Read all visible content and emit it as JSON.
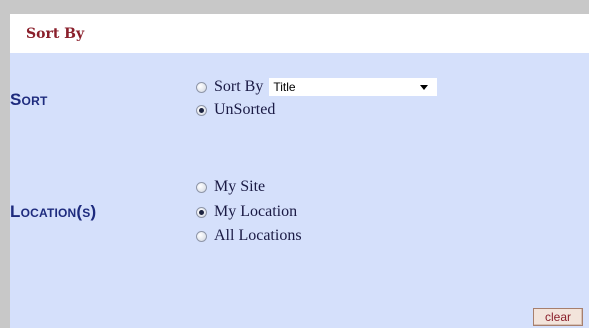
{
  "header": {
    "title": "Sort By"
  },
  "sort": {
    "label": "Sort",
    "options": [
      {
        "label": "Sort By",
        "checked": false
      },
      {
        "label": "UnSorted",
        "checked": true
      }
    ],
    "select_value": "Title"
  },
  "location": {
    "label": "Location(s)",
    "options": [
      {
        "label": "My Site",
        "checked": false
      },
      {
        "label": "My Location",
        "checked": true
      },
      {
        "label": "All Locations",
        "checked": false
      }
    ]
  },
  "actions": {
    "clear_label": "clear"
  },
  "colors": {
    "panel_bg": "#d5e0fb",
    "header_title": "#8a1f2b",
    "section_label": "#1e2b7e"
  },
  "icons": {
    "select": "chevron-down-icon",
    "radio_unchecked": "radio-unchecked-icon",
    "radio_checked": "radio-checked-icon"
  }
}
